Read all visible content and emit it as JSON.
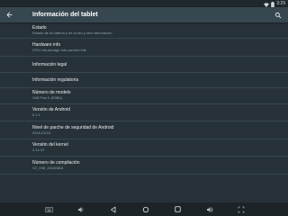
{
  "status_bar": {
    "time": "3:29",
    "icons": [
      "wifi-icon",
      "battery-icon"
    ]
  },
  "app_bar": {
    "title": "Información del tablet",
    "back_icon": "arrow-back-icon",
    "search_icon": "search-icon"
  },
  "items": [
    {
      "title": "Estado",
      "subtitle": "Estado de la batería y de la red y otra información"
    },
    {
      "title": "Hardware info",
      "subtitle": "CPU info,storage info,camera info"
    },
    {
      "title": "Información legal",
      "subtitle": ""
    },
    {
      "title": "Información regulatoria",
      "subtitle": ""
    },
    {
      "title": "Número de modelo",
      "subtitle": "X98 Plus II (E5B6)"
    },
    {
      "title": "Versión de Android",
      "subtitle": "5.1.1"
    },
    {
      "title": "Nivel de parche de seguridad de Android",
      "subtitle": "2016-03-01"
    },
    {
      "title": "Versión del kernel",
      "subtitle": "3.14.37"
    },
    {
      "title": "Número de compilación",
      "subtitle": "V2_X98_20160816"
    }
  ],
  "nav_bar": {
    "icons": [
      "keyboard-icon",
      "volume-down-icon",
      "back-icon",
      "home-icon",
      "recents-icon",
      "volume-up-icon",
      "screenshot-icon"
    ]
  }
}
